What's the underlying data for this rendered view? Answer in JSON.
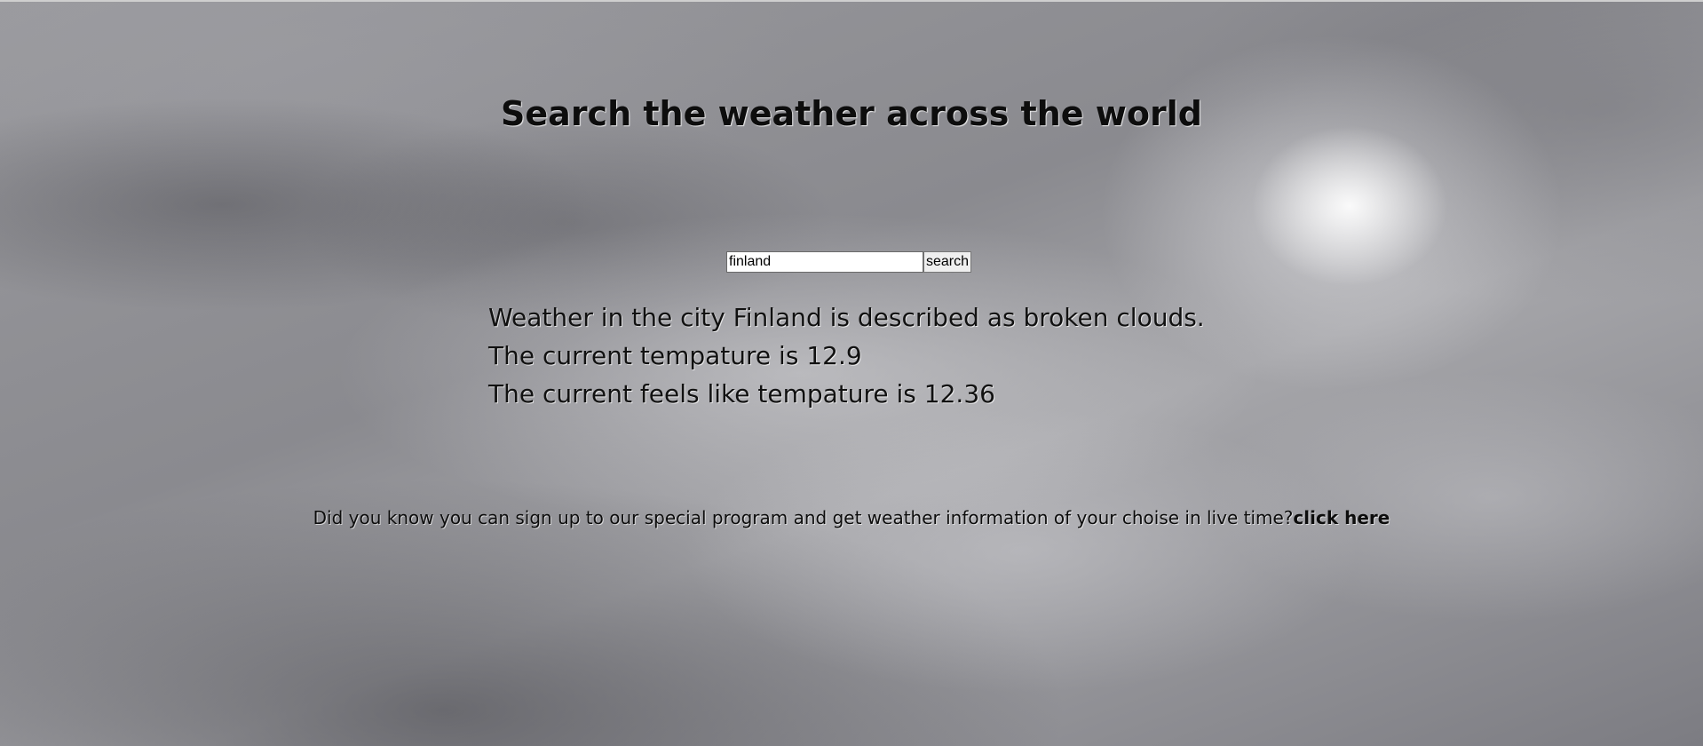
{
  "header": {
    "title": "Search the weather across the world"
  },
  "search": {
    "value": "finland",
    "button_label": "search"
  },
  "results": {
    "description_line": "Weather in the city Finland is described as broken clouds.",
    "temperature_line": "The current tempature is 12.9",
    "feels_like_line": "The current feels like tempature is 12.36"
  },
  "promo": {
    "text": "Did you know you can sign up to our special program and get weather information of your choise in live time?",
    "link_label": "click here"
  }
}
